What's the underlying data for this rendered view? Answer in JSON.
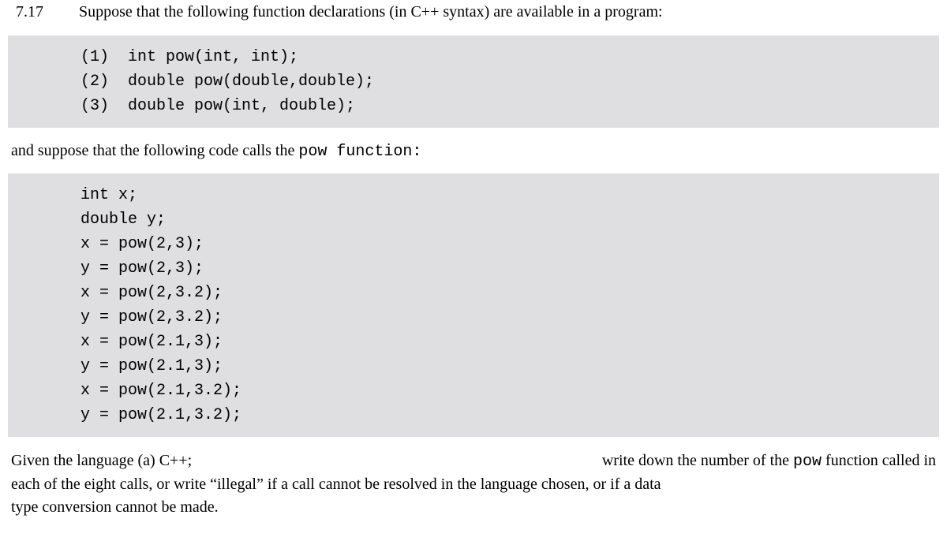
{
  "problem": {
    "number": "7.17",
    "prompt": "Suppose that the following function declarations (in C++ syntax) are available in a program:"
  },
  "decl_block": {
    "l1": "(1)  int pow(int, int);",
    "l2": "(2)  double pow(double,double);",
    "l3": "(3)  double pow(int, double);"
  },
  "intertext": {
    "prefix": "and suppose that the following code calls the ",
    "code": "pow  function:"
  },
  "call_block": {
    "l1": "int x;",
    "l2": "double y;",
    "l3": "x = pow(2,3);",
    "l4": "y = pow(2,3);",
    "l5": "x = pow(2,3.2);",
    "l6": "y = pow(2,3.2);",
    "l7": "x = pow(2.1,3);",
    "l8": "y = pow(2.1,3);",
    "l9": "x = pow(2.1,3.2);",
    "l10": "y = pow(2.1,3.2);"
  },
  "question": {
    "line1_left": "Given the language (a) C++;",
    "line1_right_prefix": "write down the number of the ",
    "line1_right_code": "pow",
    "line1_right_suffix": " function called in",
    "line2": "each of the eight calls, or write “illegal” if a call cannot be resolved in the language chosen, or if a data",
    "line3": "type conversion cannot be made."
  }
}
